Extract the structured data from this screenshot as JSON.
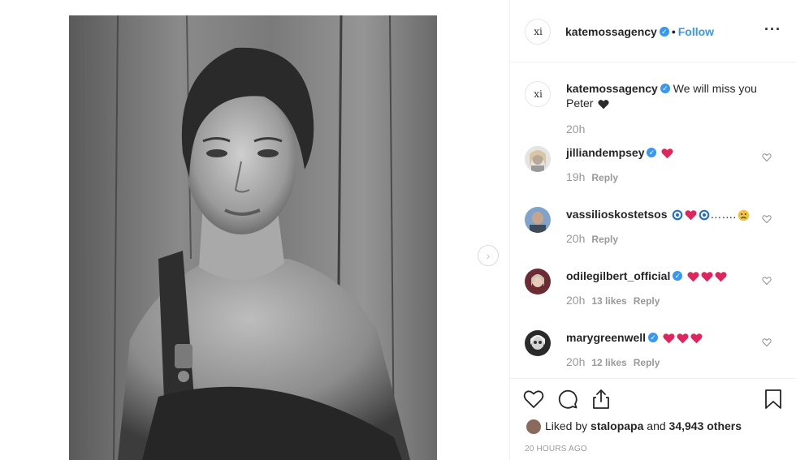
{
  "post": {
    "username": "katemossagency",
    "separator": "•",
    "follow_label": "Follow",
    "more_label": "···",
    "logo_text": "ⅺ"
  },
  "comments": [
    {
      "username": "katemossagency",
      "text": "We will miss you Peter",
      "time": "20h",
      "likes": "",
      "reply": ""
    },
    {
      "username": "jilliandempsey",
      "text": "",
      "time": "19h",
      "likes": "",
      "reply": "Reply"
    },
    {
      "username": "vassilioskostetsos",
      "text": "…….",
      "time": "20h",
      "likes": "",
      "reply": "Reply"
    },
    {
      "username": "odilegilbert_official",
      "text": "",
      "time": "20h",
      "likes": "13 likes",
      "reply": "Reply"
    },
    {
      "username": "marygreenwell",
      "text": "",
      "time": "20h",
      "likes": "12 likes",
      "reply": "Reply"
    }
  ],
  "footer": {
    "liked_prefix": "Liked by",
    "liked_user": "stalopapa",
    "liked_and": "and",
    "liked_count": "34,943 others",
    "time_ago": "20 HOURS AGO"
  },
  "colors": {
    "accent": "#3897f0",
    "heart": "#e0245e",
    "border": "#efefef",
    "muted": "#999999"
  }
}
